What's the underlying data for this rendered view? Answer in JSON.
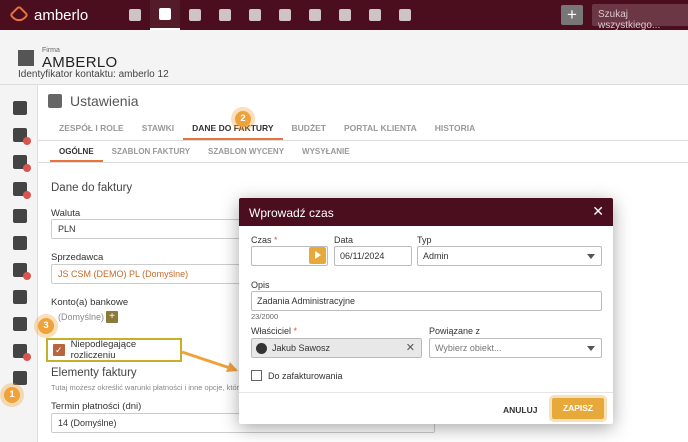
{
  "app": {
    "logo_text": "amberlo"
  },
  "topbar": {
    "nav_icons": [
      "dashboard-icon",
      "contacts-icon",
      "briefcase-icon",
      "document-icon",
      "bank-icon",
      "calendar-icon",
      "history-icon",
      "folder-icon",
      "mail-icon",
      "chart-icon"
    ],
    "plus_label": "+",
    "search_placeholder": "Szukaj wszystkiego..."
  },
  "contact": {
    "firm_label": "Firma",
    "name": "AMBERLO",
    "id_label": "Identyfikator kontaktu: amberlo 12"
  },
  "settings": {
    "title": "Ustawienia",
    "tabs": [
      "ZESPÓŁ I ROLE",
      "STAWKI",
      "DANE DO FAKTURY",
      "BUDŻET",
      "PORTAL KLIENTA",
      "HISTORIA"
    ],
    "subtabs": [
      "OGÓLNE",
      "SZABLON FAKTURY",
      "SZABLON WYCENY",
      "WYSYŁANIE"
    ]
  },
  "invoice_data": {
    "section_title": "Dane do faktury",
    "currency_label": "Waluta",
    "currency_value": "PLN",
    "seller_label": "Sprzedawca",
    "seller_value": "JS CSM (DEMO) PL (Domyślne)",
    "bank_label": "Konto(a) bankowe",
    "bank_value": "(Domyślne)",
    "add_label": "+",
    "independent_label": "Niepodlegające rozliczeniu"
  },
  "invoice_elements": {
    "section_title": "Elementy faktury",
    "hint": "Tutaj możesz określić warunki płatności i inne opcje, które b",
    "payment_term_label": "Termin płatności (dni)",
    "payment_term_value": "14 (Domyślne)"
  },
  "markers": {
    "one": "1",
    "two": "2",
    "three": "3"
  },
  "modal": {
    "title": "Wprowadź czas",
    "close": "✕",
    "time_label": "Czas",
    "required": "*",
    "time_value": "",
    "date_label": "Data",
    "date_value": "06/11/2024",
    "type_label": "Typ",
    "type_value": "Admin",
    "description_label": "Opis",
    "description_value": "Zadania Administracyjne",
    "counter": "23/2000",
    "owner_label": "Właściciel",
    "owner_value": "Jakub Sawosz",
    "owner_clear": "✕",
    "related_label": "Powiązane z",
    "related_placeholder": "Wybierz obiekt...",
    "billable_label": "Do zafakturowania",
    "cancel_label": "ANULUJ",
    "save_label": "ZAPISZ"
  },
  "colors": {
    "brand_dark": "#4a0e1e",
    "accent": "#e8743b",
    "highlight": "#f0a23a"
  }
}
